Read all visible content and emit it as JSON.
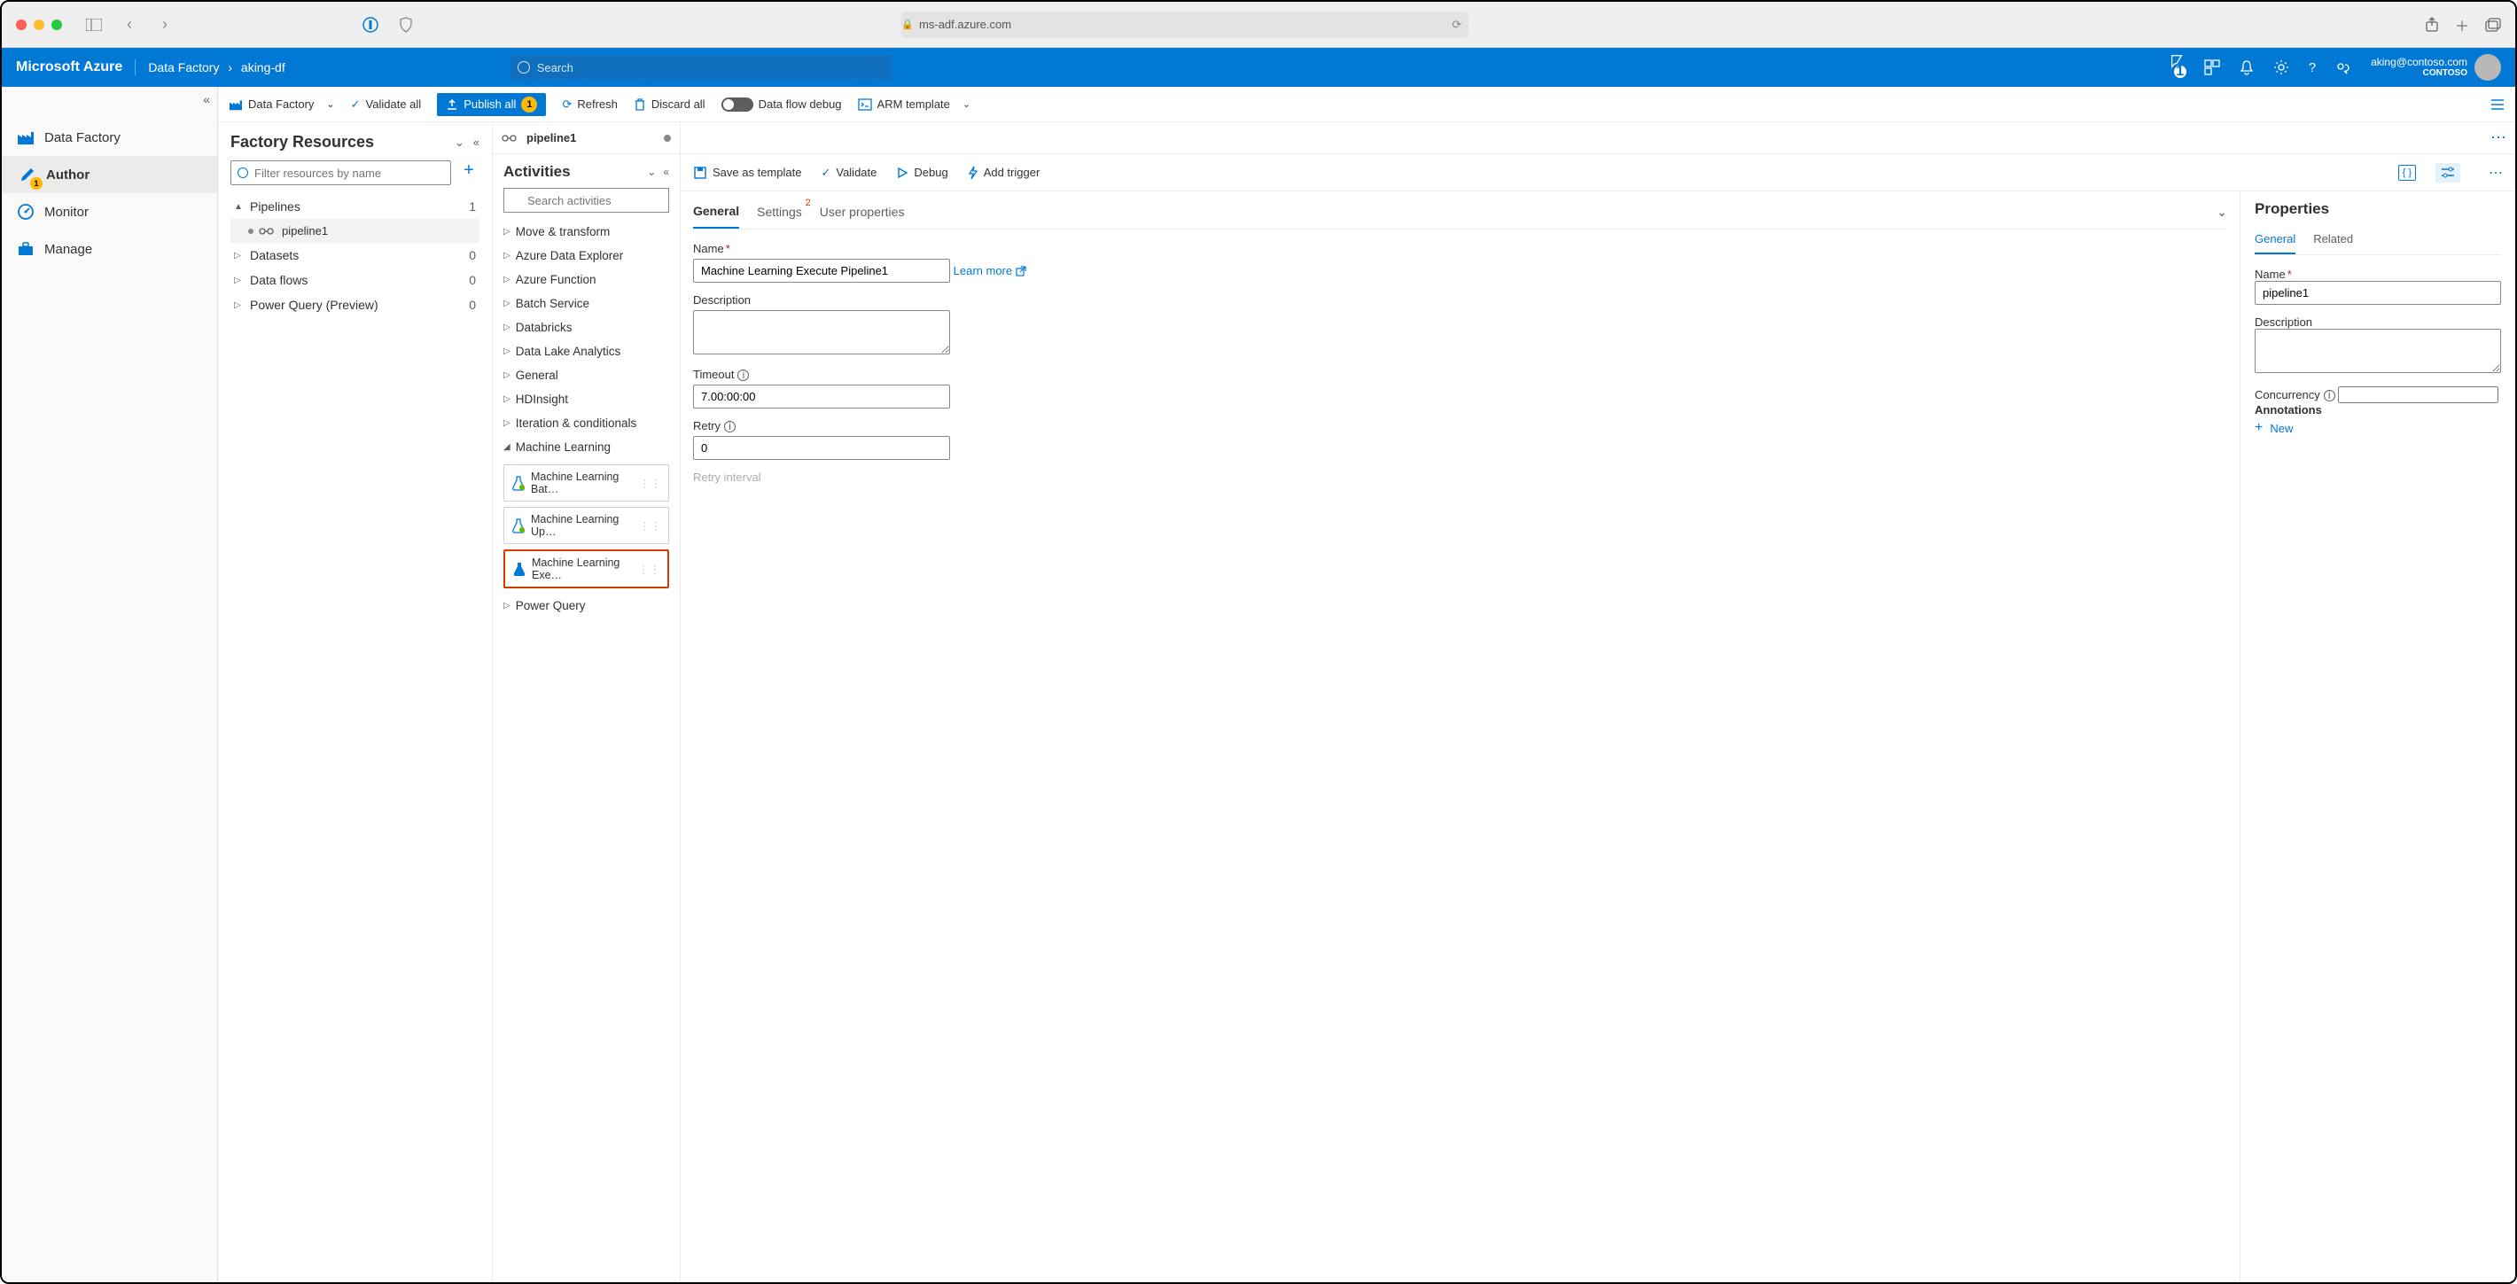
{
  "browser": {
    "url": "ms-adf.azure.com"
  },
  "header": {
    "brand": "Microsoft Azure",
    "breadcrumb": {
      "root": "Data Factory",
      "current": "aking-df"
    },
    "search_placeholder": "Search",
    "notification_count": "1",
    "user": {
      "email": "aking@contoso.com",
      "org": "CONTOSO"
    }
  },
  "left_nav": {
    "items": [
      {
        "label": "Data Factory",
        "icon": "factory-icon"
      },
      {
        "label": "Author",
        "icon": "pencil-icon",
        "badge": "1"
      },
      {
        "label": "Monitor",
        "icon": "gauge-icon"
      },
      {
        "label": "Manage",
        "icon": "toolbox-icon"
      }
    ]
  },
  "toolbar": {
    "df": "Data Factory",
    "validate_all": "Validate all",
    "publish_all": "Publish all",
    "publish_badge": "1",
    "refresh": "Refresh",
    "discard": "Discard all",
    "dataflow": "Data flow debug",
    "arm": "ARM template"
  },
  "resources": {
    "title": "Factory Resources",
    "filter_placeholder": "Filter resources by name",
    "groups": [
      {
        "name": "Pipelines",
        "count": "1",
        "expanded": true
      },
      {
        "name": "Datasets",
        "count": "0"
      },
      {
        "name": "Data flows",
        "count": "0"
      },
      {
        "name": "Power Query (Preview)",
        "count": "0"
      }
    ],
    "pipeline_child": "pipeline1"
  },
  "activities": {
    "tab_label": "pipeline1",
    "title": "Activities",
    "search_placeholder": "Search activities",
    "categories": [
      "Move & transform",
      "Azure Data Explorer",
      "Azure Function",
      "Batch Service",
      "Databricks",
      "Data Lake Analytics",
      "General",
      "HDInsight",
      "Iteration & conditionals",
      "Machine Learning",
      "Power Query"
    ],
    "ml_items": [
      "Machine Learning Bat…",
      "Machine Learning Up…",
      "Machine Learning Exe…"
    ]
  },
  "canvas_tb": {
    "save": "Save as template",
    "validate": "Validate",
    "debug": "Debug",
    "trigger": "Add trigger"
  },
  "general": {
    "tabs": {
      "general": "General",
      "settings": "Settings",
      "settings_sup": "2",
      "user_props": "User properties"
    },
    "name_label": "Name",
    "name_value": "Machine Learning Execute Pipeline1",
    "learn_more": "Learn more",
    "desc_label": "Description",
    "desc_value": "",
    "timeout_label": "Timeout",
    "timeout_value": "7.00:00:00",
    "retry_label": "Retry",
    "retry_value": "0",
    "retry_interval_label": "Retry interval"
  },
  "props": {
    "title": "Properties",
    "tabs": {
      "general": "General",
      "related": "Related"
    },
    "name_label": "Name",
    "name_value": "pipeline1",
    "desc_label": "Description",
    "desc_value": "",
    "conc_label": "Concurrency",
    "conc_value": "",
    "ann_label": "Annotations",
    "new_label": "New"
  }
}
